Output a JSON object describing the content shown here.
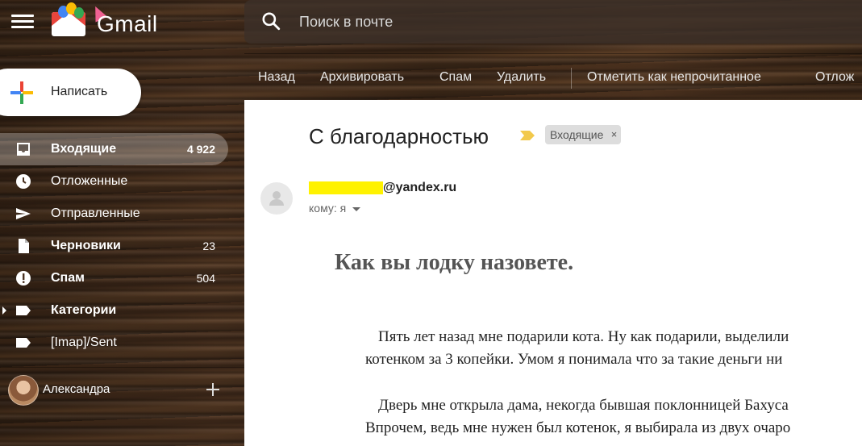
{
  "header": {
    "app_name": "Gmail",
    "search_placeholder": "Поиск в почте"
  },
  "compose": {
    "label": "Написать"
  },
  "sidebar": {
    "items": [
      {
        "label": "Входящие",
        "count": "4 922",
        "icon": "inbox-icon"
      },
      {
        "label": "Отложенные",
        "count": "",
        "icon": "clock-icon"
      },
      {
        "label": "Отправленные",
        "count": "",
        "icon": "send-icon"
      },
      {
        "label": "Черновики",
        "count": "23",
        "icon": "draft-icon"
      },
      {
        "label": "Спам",
        "count": "504",
        "icon": "spam-icon"
      },
      {
        "label": "Категории",
        "count": "",
        "icon": "label-icon"
      },
      {
        "label": "[Imap]/Sent",
        "count": "",
        "icon": "label-icon"
      }
    ],
    "user": {
      "name": "Александра"
    }
  },
  "toolbar": {
    "back": "Назад",
    "archive": "Архивировать",
    "spam": "Спам",
    "delete": "Удалить",
    "mark_unread": "Отметить как непрочитанное",
    "snooze": "Отлож"
  },
  "message": {
    "subject": "С благодарностью",
    "label_chip": "Входящие",
    "chip_close": "×",
    "sender_domain": "@yandex.ru",
    "to_line": "кому: я",
    "title": "Как вы лодку назовете.",
    "paragraphs": [
      "Пять лет назад мне подарили кота. Ну как подарили, выделили",
      "котенком за 3 копейки. Умом я понимала что за такие деньги ни",
      "Дверь мне открыла дама, некогда бывшая поклонницей Бахуса",
      "Впрочем, ведь мне нужен был котенок, я выбирала из двух очаро"
    ]
  },
  "colors": {
    "accent_yellow_highlight": "#fff200",
    "importance_marker": "#f2c94c",
    "chip_bg": "#dddddd"
  }
}
